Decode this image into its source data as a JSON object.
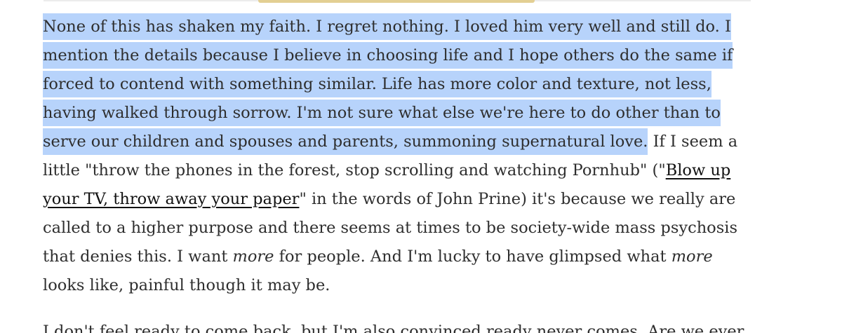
{
  "article": {
    "paragraph1": {
      "lines": [
        {
          "highlighted": "None of this has shaken my faith. I regret nothing. I loved him very well and still do. I"
        },
        {
          "highlighted": "mention the details because I believe in choosing life and I hope others do the same if"
        },
        {
          "highlighted": "forced to contend with something similar. Life has more color and texture, not less,"
        },
        {
          "highlighted": "having walked through sorrow. I'm not sure what else we're here to do other than to"
        },
        {
          "highlighted": "serve our children and spouses and parents, summoning supernatural love.",
          "after": " If I seem a"
        },
        {
          "text": "little \"throw the phones in the forest, stop scrolling and watching Pornhub\" (\"",
          "link": "Blow up"
        },
        {
          "link": "your TV, throw away your paper",
          "after": "\" in the words of John Prine) it's because we really are"
        },
        {
          "text": "called to a higher purpose and there seems at times to be society-wide mass psychosis"
        },
        {
          "before": "that denies this. I want ",
          "em1": "more",
          "middle": " for people. And I'm lucky to have glimpsed what ",
          "em2": "more"
        },
        {
          "text": "looks like, painful though it may be."
        }
      ]
    },
    "paragraph2": {
      "line": "I don't feel ready to come back, but I'm also convinced ready never comes. Are we ever"
    }
  }
}
